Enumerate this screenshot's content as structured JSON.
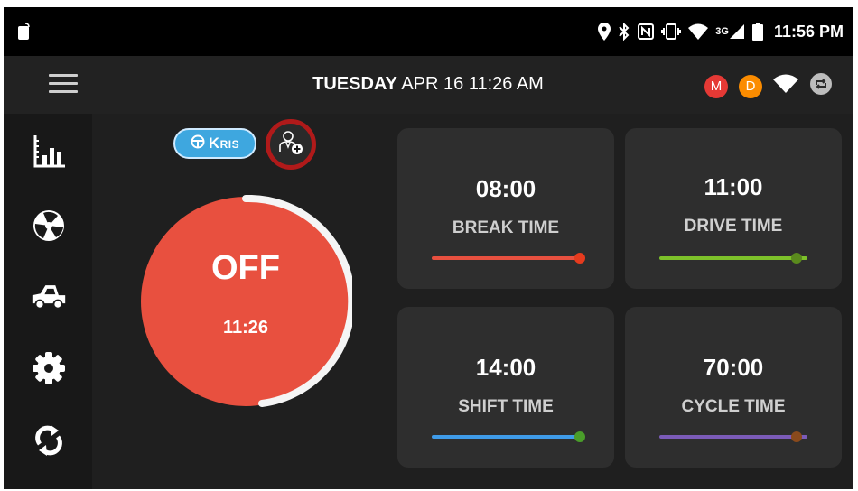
{
  "status_bar": {
    "time": "11:56 PM",
    "network": "3G"
  },
  "header": {
    "day": "TUESDAY",
    "date_time": "APR 16 11:26 AM",
    "badges": [
      {
        "letter": "M",
        "color": "#e53935"
      },
      {
        "letter": "D",
        "color": "#fb8c00"
      }
    ]
  },
  "driver": {
    "name": "Kris"
  },
  "duty_status": {
    "label": "OFF",
    "time": "11:26",
    "color": "#e8503f",
    "ring_color": "#f5f5f5"
  },
  "cards": [
    {
      "value": "08:00",
      "label": "BREAK TIME",
      "bar_color": "#e8503f",
      "dot_color": "#e63b1e",
      "fill": 1.0
    },
    {
      "value": "11:00",
      "label": "DRIVE TIME",
      "bar_color": "#7dc12a",
      "dot_color": "#5a8a1d",
      "fill": 1.0
    },
    {
      "value": "14:00",
      "label": "SHIFT TIME",
      "bar_color": "#3f9be8",
      "dot_color": "#4a9d2a",
      "fill": 1.0
    },
    {
      "value": "70:00",
      "label": "CYCLE TIME",
      "bar_color": "#7b5bb8",
      "dot_color": "#8a4a1c",
      "fill": 1.0
    }
  ],
  "sidebar": [
    {
      "name": "logs-chart-icon"
    },
    {
      "name": "inspection-icon"
    },
    {
      "name": "truck-icon"
    },
    {
      "name": "settings-icon"
    },
    {
      "name": "sync-icon"
    }
  ]
}
